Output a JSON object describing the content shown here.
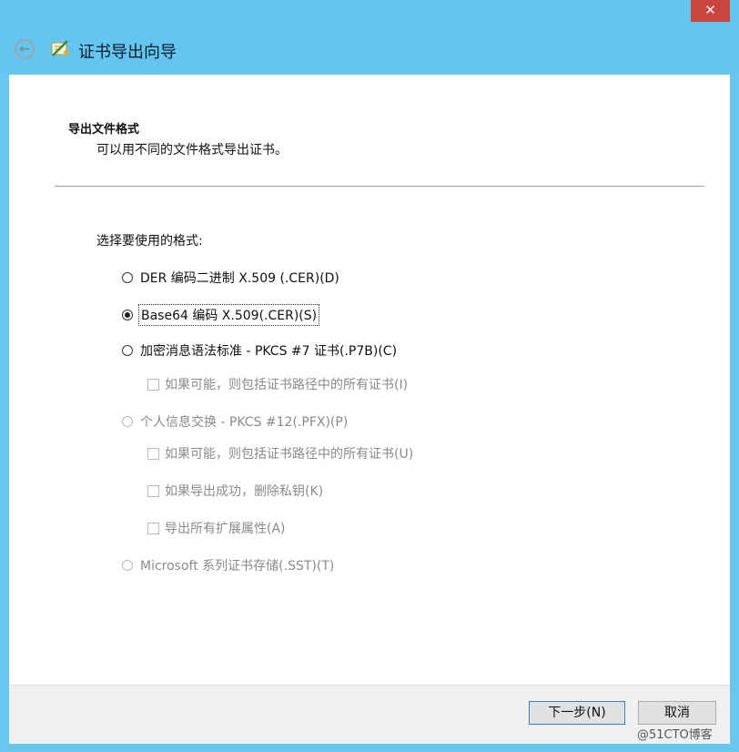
{
  "window": {
    "close_glyph": "✕",
    "back_glyph": "←",
    "title": "证书导出向导"
  },
  "section": {
    "title": "导出文件格式",
    "subtitle": "可以用不同的文件格式导出证书。"
  },
  "format": {
    "label": "选择要使用的格式:",
    "options": [
      {
        "label": "DER 编码二进制 X.509 (.CER)(D)",
        "selected": false,
        "enabled": true
      },
      {
        "label": "Base64 编码 X.509(.CER)(S)",
        "selected": true,
        "enabled": true
      },
      {
        "label": "加密消息语法标准 - PKCS #7 证书(.P7B)(C)",
        "selected": false,
        "enabled": true
      },
      {
        "label": "个人信息交换 - PKCS #12(.PFX)(P)",
        "selected": false,
        "enabled": false
      },
      {
        "label": "Microsoft 系列证书存储(.SST)(T)",
        "selected": false,
        "enabled": false
      }
    ],
    "pkcs7_include_all": "如果可能，则包括证书路径中的所有证书(I)",
    "pkcs12_include_all": "如果可能，则包括证书路径中的所有证书(U)",
    "pkcs12_delete_key": "如果导出成功，删除私钥(K)",
    "pkcs12_export_props": "导出所有扩展属性(A)"
  },
  "buttons": {
    "next": "下一步(N)",
    "cancel": "取消"
  },
  "watermark": "@51CTO博客"
}
